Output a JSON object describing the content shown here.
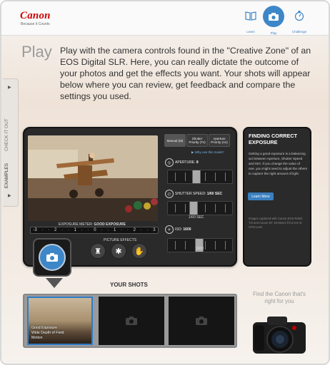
{
  "header": {
    "brand": "Canon",
    "tagline": "Because it Counts",
    "nav": [
      {
        "label": "Learn",
        "icon": "book-icon"
      },
      {
        "label": "Play",
        "icon": "camera-icon",
        "active": true
      },
      {
        "label": "Challenge",
        "icon": "stopwatch-icon"
      }
    ]
  },
  "sidebar": {
    "tab_check": "CHECK IT OUT",
    "tab_examples": "EXAMPLES"
  },
  "main": {
    "title": "Play",
    "intro": "Play with the camera controls found in the \"Creative Zone\" of an EOS Digital SLR. Here, you can really dictate the outcome of your photos and get the effects you want. Your shots will appear below where you can review, get feedback and compare the settings you used."
  },
  "camera": {
    "modes": [
      {
        "label": "Manual (M)",
        "active": true
      },
      {
        "label": "Shutter Priority (Tv)",
        "active": false
      },
      {
        "label": "Aperture Priority (Av)",
        "active": false
      }
    ],
    "why_link": "▶ Why use this mode?",
    "aperture": {
      "label": "APERTURE:",
      "value": "8"
    },
    "shutter": {
      "label": "SHUTTER SPEED:",
      "value": "1/60 SEC",
      "slider_value": "1/60 SEC"
    },
    "iso": {
      "label": "ISO:",
      "value": "1600",
      "slider_value": "1600"
    },
    "exposure_meter": {
      "label": "EXPOSURE METER:",
      "value": "GOOD EXPOSURE",
      "scale": [
        "-3",
        "·",
        "·",
        "2",
        "·",
        "·",
        "1",
        "·",
        "·",
        "0",
        "·",
        "·",
        "1",
        "·",
        "·",
        "2",
        "·",
        "·",
        "3"
      ]
    },
    "picture_effects_label": "PICTURE EFFECTS",
    "effects": [
      "silhouette-icon",
      "fan-icon",
      "hand-icon"
    ]
  },
  "info_panel": {
    "title": "FINDING CORRECT EXPOSURE",
    "body": "Getting a good exposure is a balancing act between Aperture, Shutter Speed and ISO. If you change the value of one, you might need to adjust the others to capture the right amount of light.",
    "button": "Learn More",
    "caption": "Images captured with Canon EOS Rebel T4i and Canon EF 18-55mm f/3.5-5.6 IS STM Lens"
  },
  "shots": {
    "title": "YOUR SHOTS",
    "items": [
      {
        "lines": [
          "Good Exposure",
          "Wide Depth of Field",
          "Motion"
        ],
        "has_photo": true
      },
      {
        "lines": [],
        "has_photo": false
      },
      {
        "lines": [],
        "has_photo": false
      }
    ]
  },
  "promo": {
    "text": "Find the Canon that's right for you"
  },
  "colors": {
    "brand": "#cc0000",
    "accent": "#3d87c8",
    "panel": "#2a2a2a"
  }
}
